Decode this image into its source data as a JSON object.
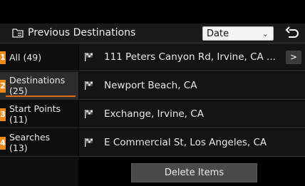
{
  "header": {
    "title": "Previous Destinations",
    "sort_select": {
      "value": "Date",
      "chevron": "⌄"
    },
    "back_icon": "back-arrow-icon"
  },
  "sidebar": {
    "items": [
      {
        "label": "All (49)",
        "badge": "1",
        "active": false
      },
      {
        "label": "Destinations",
        "count": "(25)",
        "badge": "2",
        "active": true
      },
      {
        "label": "Start Points",
        "count": "(11)",
        "badge": "3",
        "active": false
      },
      {
        "label": "Searches",
        "count": "(13)",
        "badge": "4",
        "active": false
      }
    ]
  },
  "list": {
    "rows": [
      {
        "icon": "checkered-flag-icon",
        "text": "111 Peters Canyon Rd, Irvine, CA ...",
        "arrow": ">"
      },
      {
        "icon": "checkered-flag-icon",
        "text": "Newport Beach, CA"
      },
      {
        "icon": "checkered-flag-icon",
        "text": "Exchange, Irvine, CA"
      },
      {
        "icon": "checkered-flag-icon",
        "text": "E Commercial St, Los Angeles, CA"
      }
    ]
  },
  "footer": {
    "delete_label": "Delete Items"
  },
  "colors": {
    "accent": "#ee8a1c",
    "background": "#000000",
    "row": "#141414"
  }
}
